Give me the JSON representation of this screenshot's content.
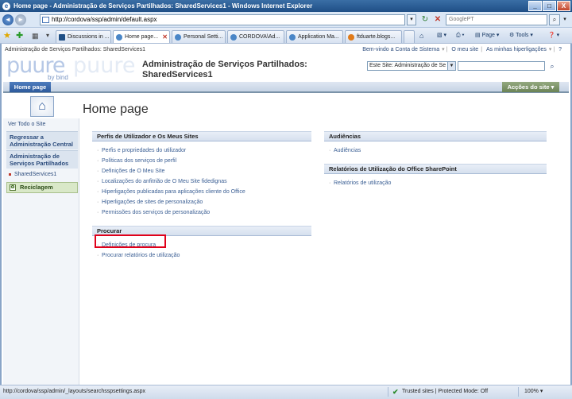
{
  "window": {
    "title": "Home page - Administração de Serviços Partilhados: SharedServices1 - Windows Internet Explorer",
    "min": "_",
    "max": "□",
    "close": "X"
  },
  "address": {
    "back": "◄",
    "forward": "►",
    "url": "http://cordova/ssp/admin/default.aspx",
    "refresh": "↻",
    "stop": "✕",
    "search_placeholder": "GooglePT",
    "search_go": "⌕"
  },
  "tabs": [
    {
      "label": "Discussions in ..."
    },
    {
      "label": "Home page..."
    },
    {
      "label": "Personal Setti..."
    },
    {
      "label": "CORDOVA\\Ad..."
    },
    {
      "label": "Application Ma..."
    },
    {
      "label": "ftduarte.blogs..."
    }
  ],
  "command_bar": {
    "page": "Page ▾",
    "tools": "Tools ▾",
    "help": "❓ ▾"
  },
  "sharepoint": {
    "breadcrumb": "Administração de Serviços Partilhados: SharedServices1",
    "welcome": "Bem-vindo a Conta de Sistema",
    "my_site": "O meu site",
    "my_links": "As minhas hiperligações",
    "logo_main": "puure",
    "logo_ghost": "puure",
    "logo_by": "by bind",
    "site_title_line1": "Administração de Serviços Partilhados:",
    "site_title_line2": "SharedServices1",
    "search_scope": "Este Site: Administração de Se",
    "home_tab": "Home page",
    "site_actions": "Acções do site ▾",
    "page_title": "Home page",
    "left_nav": {
      "view_all": "Ver Todo o Site",
      "back_to_admin": "Regressar a Administração Central",
      "ssp_admin": "Administração de Serviços Partilhados",
      "shared_services": "SharedServices1",
      "recycle_bin": "Reciclagem"
    },
    "webparts": {
      "profiles": {
        "title": "Perfis de Utilizador e Os Meus Sites",
        "links": [
          "Perfis e propriedades do utilizador",
          "Políticas dos serviços de perfil",
          "Definições de O Meu Site",
          "Localizações do anfitrião de O Meu Site fidedignas",
          "Hiperligações publicadas para aplicações cliente do Office",
          "Hiperligações de sites de personalização",
          "Permissões dos serviços de personalização"
        ]
      },
      "search": {
        "title": "Procurar",
        "links": [
          "Definições de procura",
          "Procurar relatórios de utilização"
        ]
      },
      "audiences": {
        "title": "Audiências",
        "links": [
          "Audiências"
        ]
      },
      "usage": {
        "title": "Relatórios de Utilização do Office SharePoint",
        "links": [
          "Relatórios de utilização"
        ]
      }
    }
  },
  "status": {
    "url": "http://cordova/ssp/admin/_layouts/searchsspsettings.aspx",
    "zone": "Trusted sites | Protected Mode: Off",
    "zoom": "100% ▾"
  }
}
